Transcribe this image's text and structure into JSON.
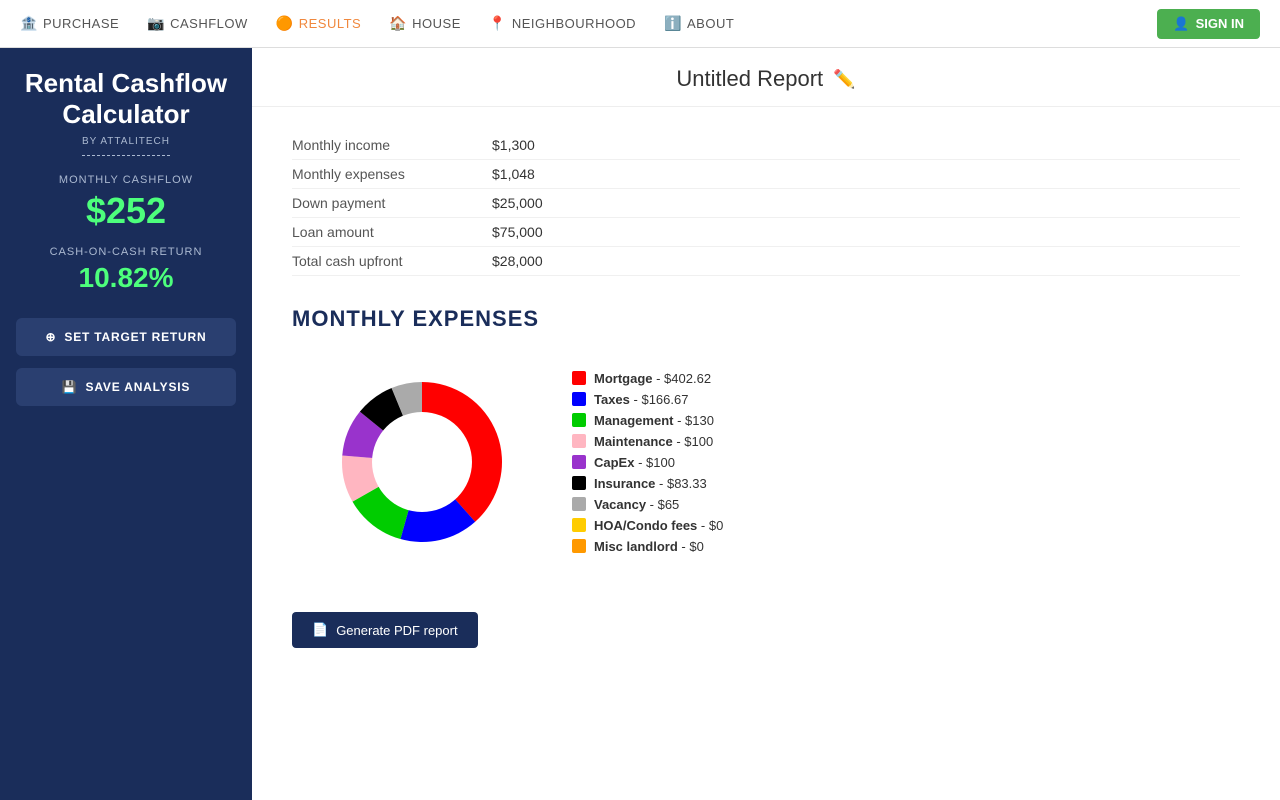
{
  "nav": {
    "items": [
      {
        "id": "purchase",
        "label": "PURCHASE",
        "icon": "🏦",
        "active": false
      },
      {
        "id": "cashflow",
        "label": "CASHFLOW",
        "icon": "🎥",
        "active": false
      },
      {
        "id": "results",
        "label": "RESULTS",
        "icon": "📊",
        "active": true
      },
      {
        "id": "house",
        "label": "HOUSE",
        "icon": "🏠",
        "active": false
      },
      {
        "id": "neighbourhood",
        "label": "NEIGHBOURHOOD",
        "icon": "📍",
        "active": false
      },
      {
        "id": "about",
        "label": "ABOUT",
        "icon": "ℹ️",
        "active": false
      }
    ],
    "sign_in_label": "SIGN IN"
  },
  "sidebar": {
    "title": "Rental Cashflow Calculator",
    "by_label": "BY ATTALITECH",
    "monthly_cashflow_label": "MONTHLY CASHFLOW",
    "monthly_cashflow_value": "$252",
    "cash_on_cash_label": "CASH-ON-CASH RETURN",
    "cash_on_cash_value": "10.82%",
    "set_target_btn": "SET TARGET RETURN",
    "save_analysis_btn": "SAVE ANALYSIS"
  },
  "page_title": "Untitled Report",
  "summary": {
    "rows": [
      {
        "label": "Monthly income",
        "value": "$1,300"
      },
      {
        "label": "Monthly expenses",
        "value": "$1,048"
      },
      {
        "label": "Down payment",
        "value": "$25,000"
      },
      {
        "label": "Loan amount",
        "value": "$75,000"
      },
      {
        "label": "Total cash upfront",
        "value": "$28,000"
      }
    ]
  },
  "expenses": {
    "title": "MONTHLY EXPENSES",
    "chart": {
      "segments": [
        {
          "label": "Mortgage",
          "value": 402.62,
          "color": "#ff0000",
          "percent": 38.4
        },
        {
          "label": "Taxes",
          "value": 166.67,
          "color": "#0000ff",
          "percent": 15.9
        },
        {
          "label": "Management",
          "value": 130,
          "color": "#00cc00",
          "percent": 12.4
        },
        {
          "label": "Maintenance",
          "value": 100,
          "color": "#ffb6c1",
          "percent": 9.5
        },
        {
          "label": "CapEx",
          "value": 100,
          "color": "#9933cc",
          "percent": 9.5
        },
        {
          "label": "Insurance",
          "value": 83.33,
          "color": "#000000",
          "percent": 7.9
        },
        {
          "label": "Vacancy",
          "value": 65,
          "color": "#aaaaaa",
          "percent": 6.2
        },
        {
          "label": "HOA/Condo fees",
          "value": 0,
          "color": "#ffcc00",
          "percent": 0
        },
        {
          "label": "Misc landlord",
          "value": 0,
          "color": "#ff9900",
          "percent": 0
        }
      ]
    }
  },
  "pdf_btn_label": "Generate PDF report"
}
